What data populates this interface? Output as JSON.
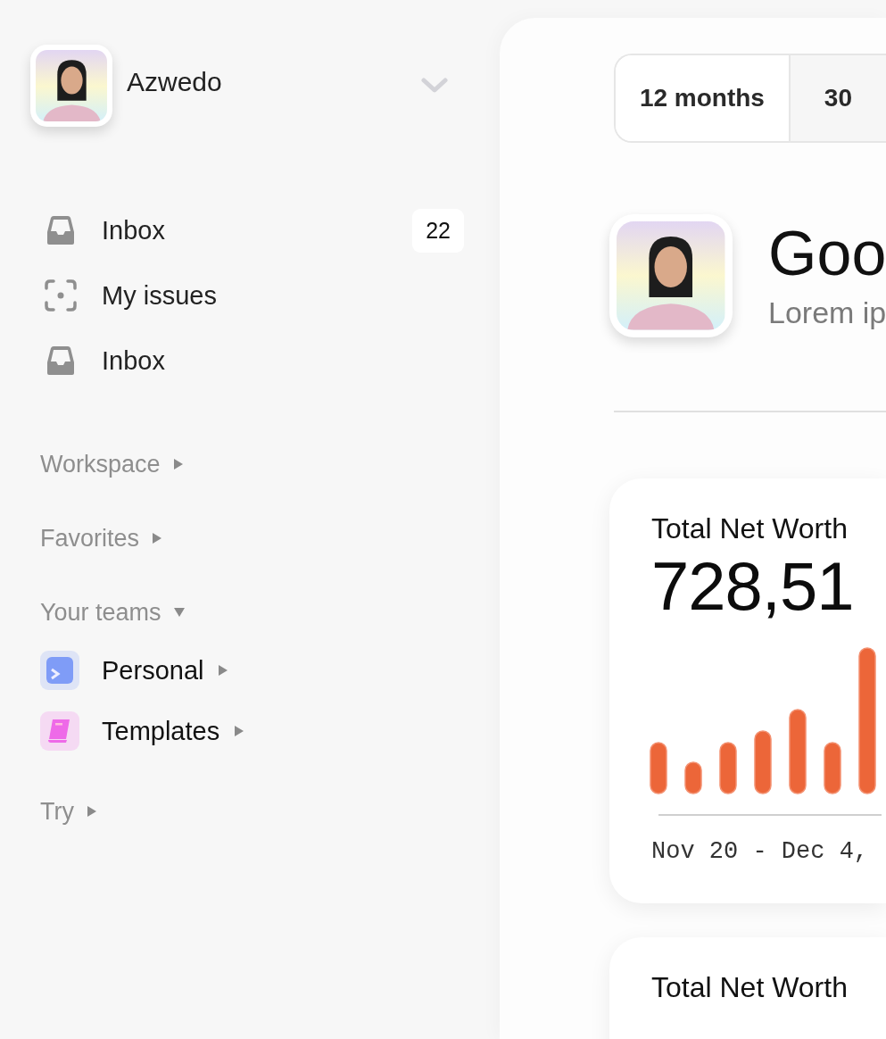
{
  "workspace": {
    "name": "Azwedo"
  },
  "nav": [
    {
      "label": "Inbox",
      "kind": "inbox",
      "badge": "22"
    },
    {
      "label": "My issues",
      "kind": "focus"
    },
    {
      "label": "Inbox",
      "kind": "inbox"
    }
  ],
  "sections": [
    {
      "label": "Workspace",
      "expanded": false
    },
    {
      "label": "Favorites",
      "expanded": false
    },
    {
      "label": "Your teams",
      "expanded": true,
      "children": [
        {
          "label": "Personal",
          "kind": "terminal",
          "color": "#7f9cf7",
          "expanded": false
        },
        {
          "label": "Templates",
          "kind": "book",
          "color": "#ee6ae8",
          "expanded": false
        }
      ]
    },
    {
      "label": "Try",
      "expanded": false
    }
  ],
  "range_tabs": [
    {
      "label": "12 months",
      "selected": true
    },
    {
      "label": "30",
      "selected": false
    }
  ],
  "greeting": {
    "title": "Goo",
    "subtitle": "Lorem ip"
  },
  "cards": [
    {
      "title": "Total Net Worth",
      "value": "728,51",
      "date_range": "Nov 20 - Dec 4,"
    },
    {
      "title": "Total Net Worth"
    }
  ]
}
